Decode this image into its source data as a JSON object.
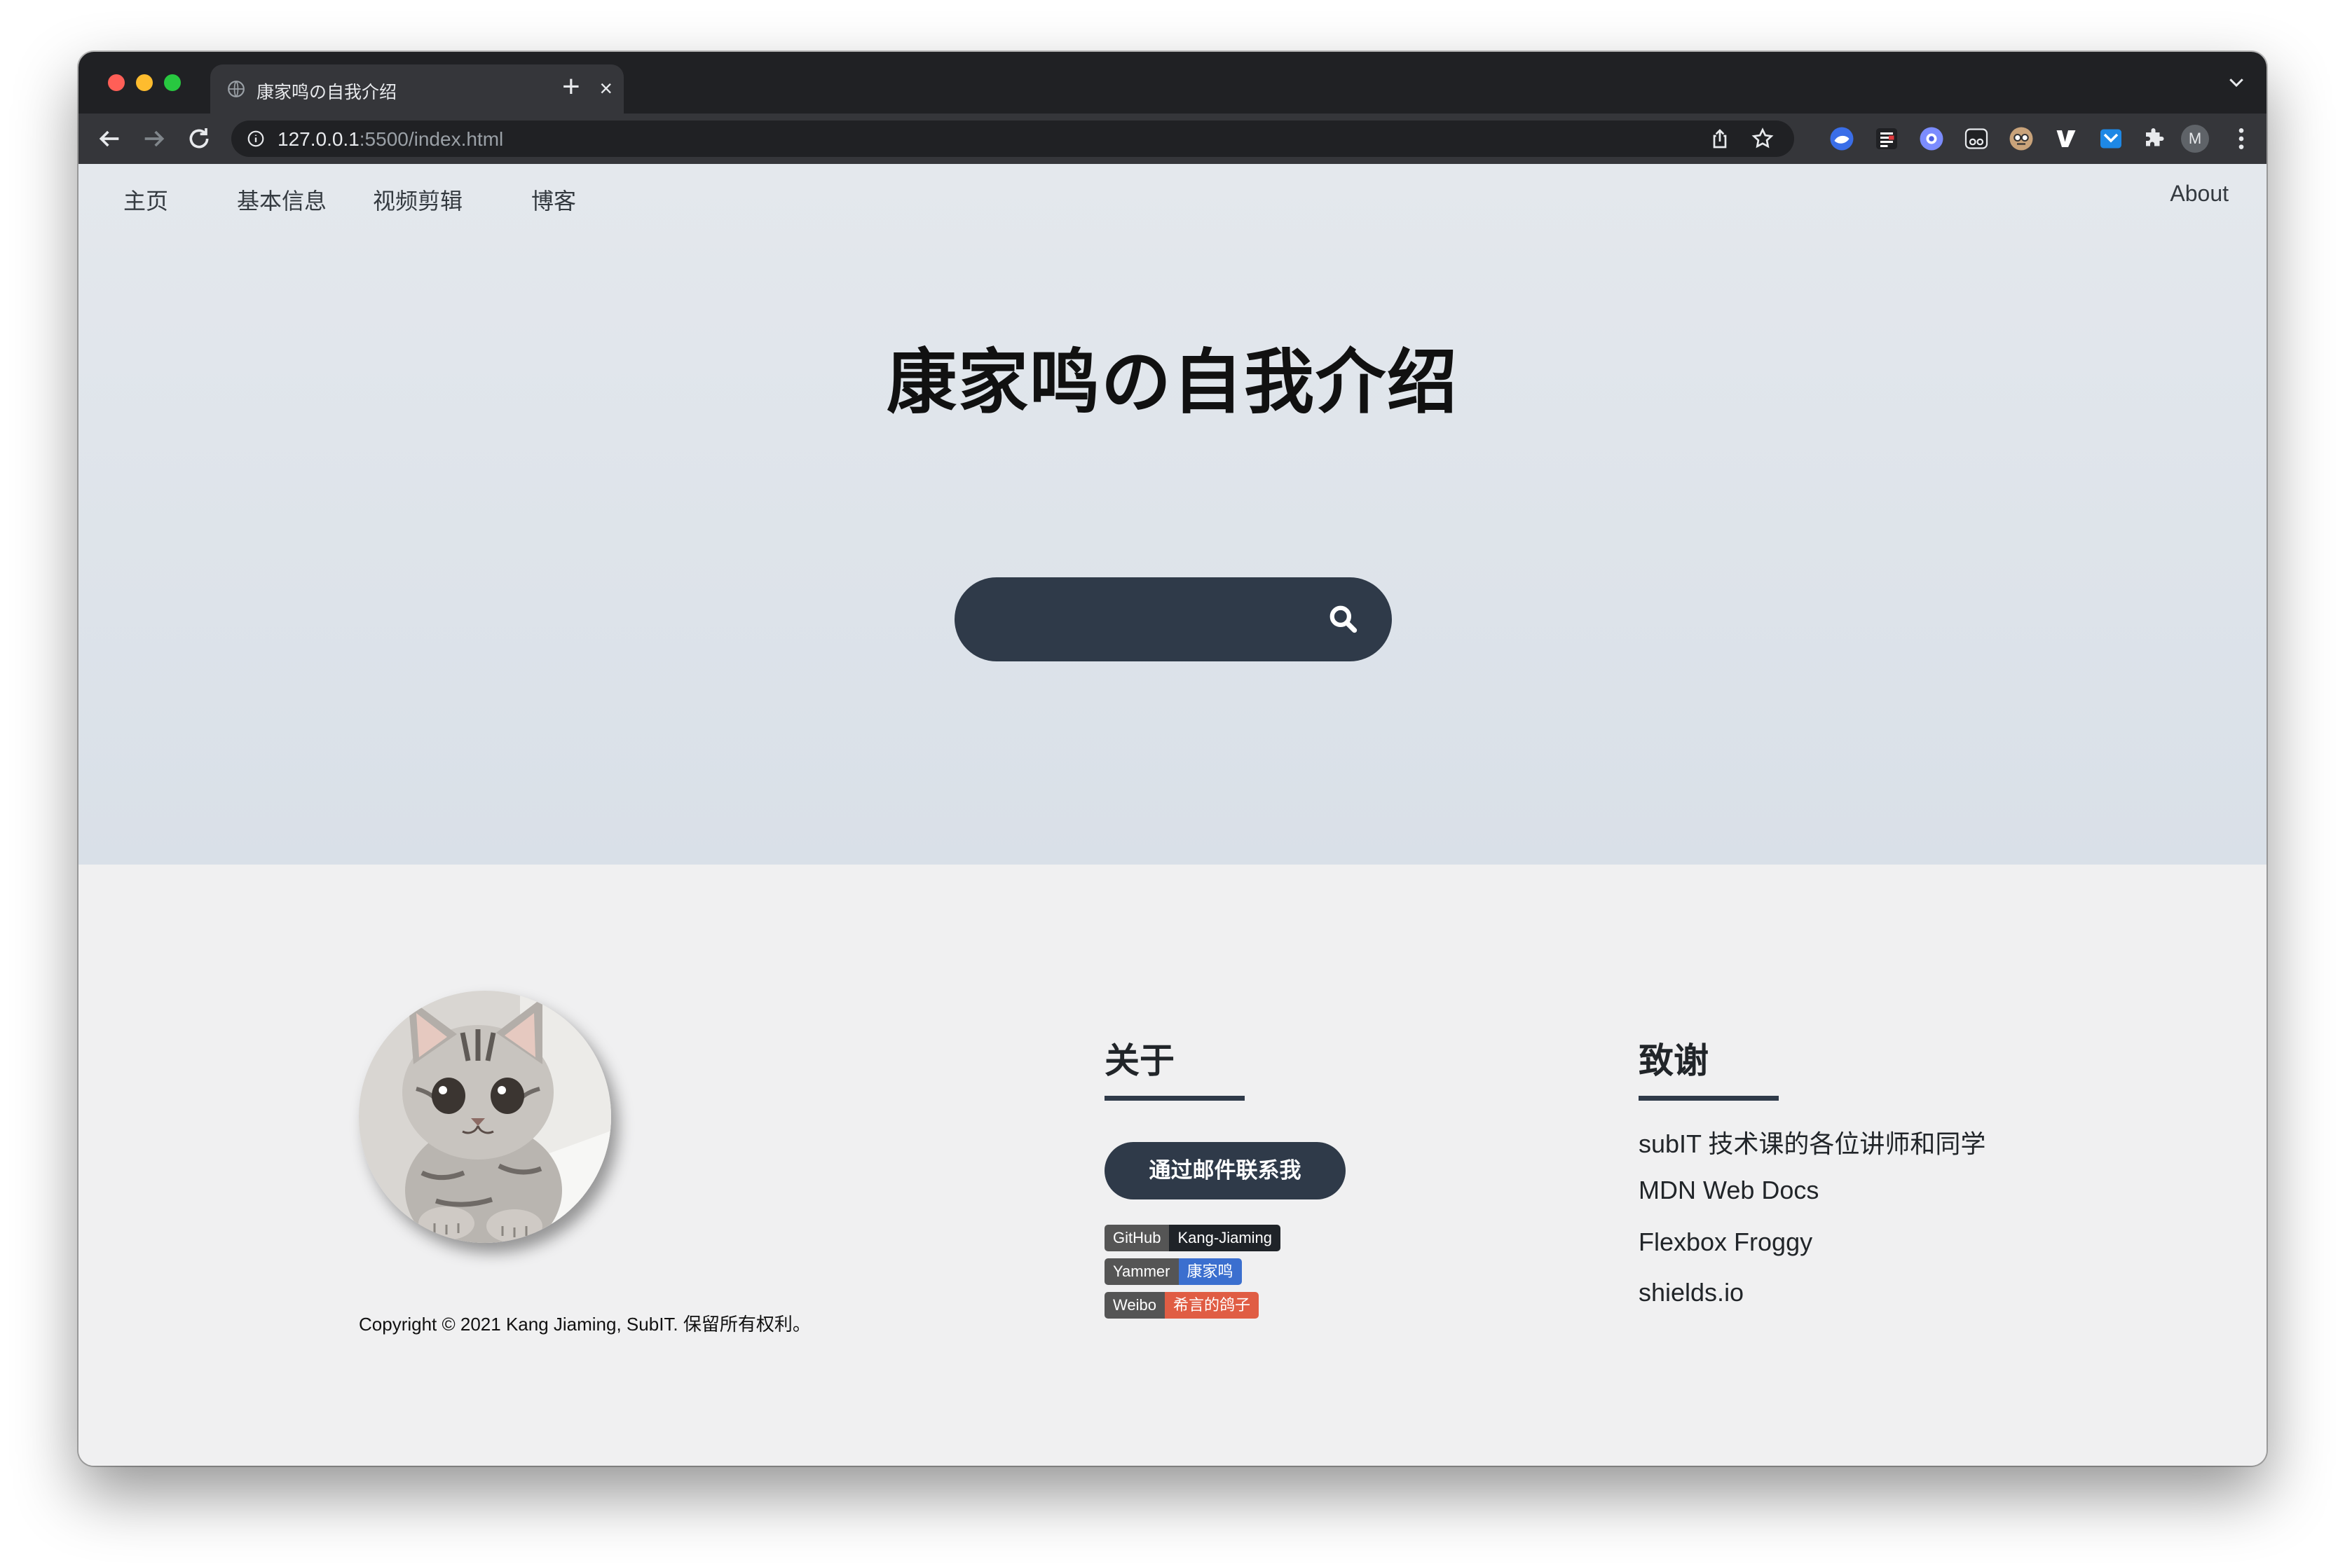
{
  "browser": {
    "tab_title": "康家鸣の自我介绍",
    "tab_close": "×",
    "new_tab": "+",
    "url_host": "127.0.0.1",
    "url_rest": ":5500/index.html",
    "profile_initial": "M"
  },
  "nav": {
    "items": [
      "主页",
      "基本信息",
      "视频剪辑",
      "博客"
    ],
    "about": "About"
  },
  "hero": {
    "title": "康家鸣の自我介绍",
    "search_placeholder": ""
  },
  "footer": {
    "copyright": "Copyright © 2021 Kang Jiaming, SubIT. 保留所有权利。",
    "about": {
      "heading": "关于",
      "email_button": "通过邮件联系我",
      "badges": [
        {
          "label": "GitHub",
          "message": "Kang-Jiaming",
          "color": "#1f2328"
        },
        {
          "label": "Yammer",
          "message": "康家鸣",
          "color": "#3b6fcf"
        },
        {
          "label": "Weibo",
          "message": "希言的鸽子",
          "color": "#e05d44"
        }
      ]
    },
    "thanks": {
      "heading": "致谢",
      "links": [
        "subIT 技术课的各位讲师和同学",
        "MDN Web Docs",
        "Flexbox Froggy",
        "shields.io"
      ]
    }
  },
  "colors": {
    "primary_dark": "#2f3a49",
    "hero_top": "#e4e8ed",
    "hero_bottom": "#d9e0e8",
    "footer_bg": "#f0f0f1"
  }
}
